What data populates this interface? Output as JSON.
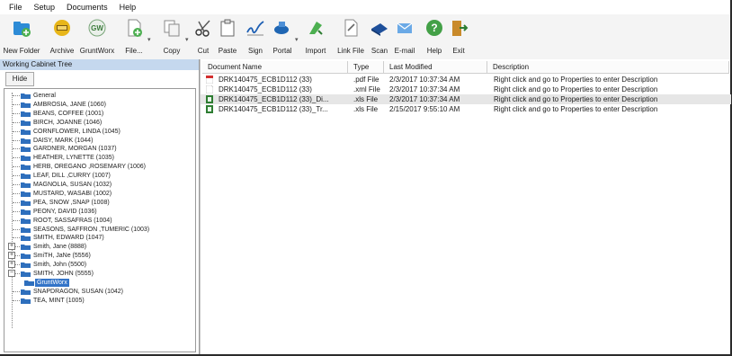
{
  "menu": [
    "File",
    "Setup",
    "Documents",
    "Help"
  ],
  "toolbar": {
    "new_folder": "New Folder",
    "archive": "Archive",
    "gruntworx": "GruntWorx",
    "file": "File...",
    "copy": "Copy",
    "cut": "Cut",
    "paste": "Paste",
    "sign": "Sign",
    "portal": "Portal",
    "import": "Import",
    "link_file": "Link File",
    "scan": "Scan",
    "email": "E-mail",
    "help": "Help",
    "exit": "Exit",
    "gruntworx_glyph": "GW",
    "help_glyph": "?",
    "dropdown_glyph": "▾"
  },
  "left": {
    "header": "Working Cabinet Tree",
    "hide": "Hide",
    "tree": [
      "General",
      "AMBROSIA, JANE (1060)",
      "BEANS, COFFEE (1001)",
      "BIRCH, JOANNE (1046)",
      "CORNFLOWER, LINDA (1045)",
      "DAISY, MARK (1044)",
      "GARDNER, MORGAN (1037)",
      "HEATHER, LYNETTE (1035)",
      "HERB, OREGANO ,ROSEMARY (1006)",
      "LEAF, DILL ,CURRY (1007)",
      "MAGNOLIA, SUSAN (1032)",
      "MUSTARD, WASABI (1002)",
      "PEA, SNOW ,SNAP (1008)",
      "PEONY, DAVID (1036)",
      "ROOT, SASSAFRAS (1004)",
      "SEASONS, SAFFRON ,TUMERIC (1003)",
      "SMITH, EDWARD (1047)",
      "Smith, Jane (8888)",
      "SmiTH, JaNe (5556)",
      "Smith, John (5500)",
      "SMITH, JOHN (5555)"
    ],
    "selected_child": "GruntWorx",
    "tree_after": [
      "SNAPDRAGON, SUSAN (1042)",
      "TEA, MINT (1005)"
    ],
    "expander_plus": "+",
    "expander_minus": "−"
  },
  "table": {
    "headers": [
      "Document Name",
      "Type",
      "Last Modified",
      "Description"
    ],
    "rows": [
      {
        "name": "DRK140475_ECB1D112 (33)",
        "type": ".pdf File",
        "modified": "2/3/2017 10:37:34 AM",
        "desc": "Right click and go to Properties to enter Description",
        "icon": "pdf"
      },
      {
        "name": "DRK140475_ECB1D112 (33)",
        "type": ".xml File",
        "modified": "2/3/2017 10:37:34 AM",
        "desc": "Right click and go to Properties to enter Description",
        "icon": "xml"
      },
      {
        "name": "DRK140475_ECB1D112 (33)_Di...",
        "type": ".xls File",
        "modified": "2/3/2017 10:37:34 AM",
        "desc": "Right click and go to Properties to enter Description",
        "icon": "xls"
      },
      {
        "name": "DRK140475_ECB1D112 (33)_Tr...",
        "type": ".xls File",
        "modified": "2/15/2017 9:55:10 AM",
        "desc": "Right click and go to Properties to enter Description",
        "icon": "xls"
      }
    ]
  },
  "colors": {
    "panel_header": "#c5d8ee",
    "selection": "#3374c8",
    "folder": "#2e6fbd",
    "row_selected": "#e6e6e6"
  }
}
